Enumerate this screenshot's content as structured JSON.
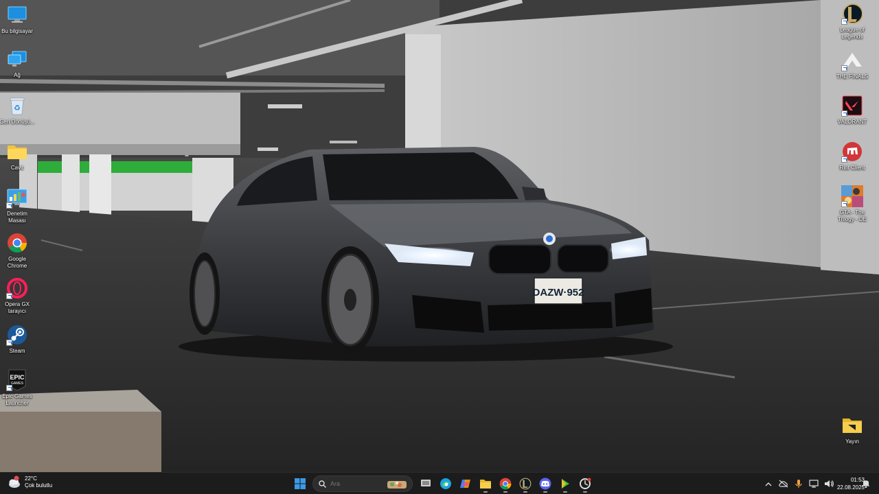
{
  "desktop": {
    "left_icons": [
      {
        "name": "bu-bilgisayar",
        "label": "Bu bilgisayar"
      },
      {
        "name": "ag",
        "label": "Ağ"
      },
      {
        "name": "geri-donusum",
        "label": "Geri Dönüşü..."
      },
      {
        "name": "cavit",
        "label": "Cavit"
      },
      {
        "name": "denetim-masasi",
        "label": "Denetim Masası"
      },
      {
        "name": "google-chrome",
        "label": "Google Chrome"
      },
      {
        "name": "opera-gx",
        "label": "Opera GX tarayıcı"
      },
      {
        "name": "steam",
        "label": "Steam"
      },
      {
        "name": "epic-games",
        "label": "Epic Games Launcher",
        "logo_text": "EPIC GAMES"
      }
    ],
    "right_icons": [
      {
        "name": "league-of-legends",
        "label": "League of Legends"
      },
      {
        "name": "the-finals",
        "label": "THE FINALS"
      },
      {
        "name": "valorant",
        "label": "VALORANT"
      },
      {
        "name": "riot-client",
        "label": "Riot Client"
      },
      {
        "name": "gta-trilogy",
        "label": "GTA - The Trilogy - DE"
      },
      {
        "name": "yayin",
        "label": "Yayın"
      }
    ],
    "wallpaper": {
      "license_plate": "DAZW·952"
    }
  },
  "taskbar": {
    "weather": {
      "temp": "22°C",
      "condition": "Çok bulutlu"
    },
    "search": {
      "placeholder": "Ara"
    },
    "clock": {
      "time": "01:53",
      "date": "22.08.2025"
    }
  },
  "colors": {
    "taskbar_bg": "#1c1c1c",
    "windows_blue": "#3a9be8",
    "valorant_red": "#ff4655",
    "riot_red": "#d13639"
  }
}
